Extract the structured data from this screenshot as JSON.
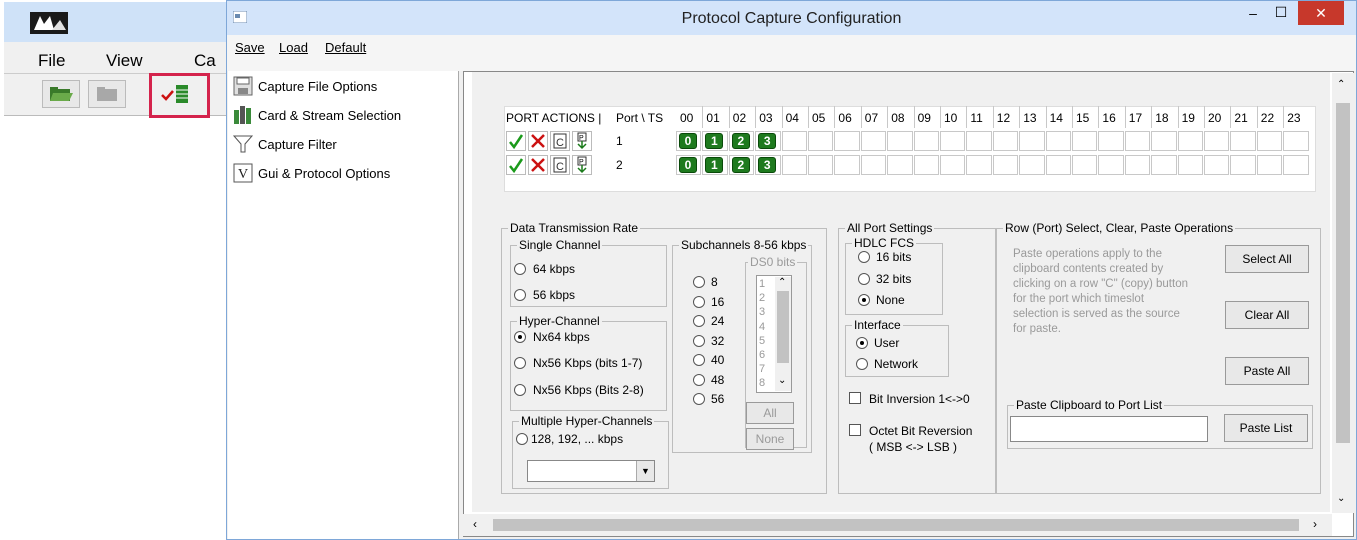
{
  "background_app": {
    "menu": [
      "File",
      "View",
      "Ca"
    ]
  },
  "window": {
    "title": "Protocol Capture Configuration",
    "controls": {
      "minimize": "–",
      "maximize": "☐",
      "close": "✕"
    }
  },
  "menu": {
    "save": "Save",
    "load": "Load",
    "default": "Default"
  },
  "nav": {
    "items": [
      {
        "label": "Capture File Options",
        "icon": "disk-icon"
      },
      {
        "label": "Card & Stream Selection",
        "icon": "card-stream-icon"
      },
      {
        "label": "Capture Filter",
        "icon": "funnel-icon"
      },
      {
        "label": "Gui & Protocol Options",
        "icon": "v-letter-icon"
      }
    ]
  },
  "grid": {
    "port_actions_header": "PORT ACTIONS  |",
    "port_ts_header": "Port \\ TS",
    "timeslots": [
      "00",
      "01",
      "02",
      "03",
      "04",
      "05",
      "06",
      "07",
      "08",
      "09",
      "10",
      "11",
      "12",
      "13",
      "14",
      "15",
      "16",
      "17",
      "18",
      "19",
      "20",
      "21",
      "22",
      "23"
    ],
    "rows": [
      {
        "port": "1",
        "selected_ts": [
          "0",
          "1",
          "2",
          "3"
        ],
        "action_icons": [
          "check-icon",
          "x-icon",
          "copy-icon",
          "paste-icon"
        ]
      },
      {
        "port": "2",
        "selected_ts": [
          "0",
          "1",
          "2",
          "3"
        ],
        "action_icons": [
          "check-icon",
          "x-icon",
          "copy-icon",
          "paste-icon"
        ]
      }
    ],
    "colors": {
      "selected_cell": "#1e7a1e",
      "check": "#1a9a1a",
      "x": "#cc1111"
    }
  },
  "data_rate": {
    "title": "Data Transmission Rate",
    "single_channel": {
      "title": "Single Channel",
      "options": [
        "64 kbps",
        "56 kbps"
      ]
    },
    "hyper_channel": {
      "title": "Hyper-Channel",
      "options": [
        "Nx64 kbps",
        "Nx56 Kbps (bits 1-7)",
        "Nx56 Kbps (Bits 2-8)"
      ],
      "selected": "Nx64 kbps"
    },
    "multiple_hyper": {
      "title": "Multiple Hyper-Channels",
      "option": "128, 192, ... kbps",
      "dropdown_value": ""
    },
    "subchannels": {
      "title": "Subchannels 8-56 kbps",
      "options": [
        "8",
        "16",
        "24",
        "32",
        "40",
        "48",
        "56"
      ],
      "ds0_title": "DS0 bits",
      "ds0_bits": [
        "1",
        "2",
        "3",
        "4",
        "5",
        "6",
        "7",
        "8"
      ],
      "all_label": "All",
      "none_label": "None"
    }
  },
  "all_port": {
    "title": "All Port Settings",
    "hdlc": {
      "title": "HDLC FCS",
      "options": [
        "16 bits",
        "32 bits",
        "None"
      ],
      "selected": "None"
    },
    "interface": {
      "title": "Interface",
      "options": [
        "User",
        "Network"
      ],
      "selected": "User"
    },
    "bit_inversion": "Bit Inversion  1<->0",
    "octet_reversal": "Octet Bit Reversion",
    "octet_reversal_sub": "( MSB <-> LSB )"
  },
  "row_ops": {
    "title": "Row (Port) Select, Clear, Paste Operations",
    "help_text": [
      "Paste operations apply to the",
      "clipboard contents created by",
      "clicking on a row \"C\" (copy) button",
      "for the port which timeslot",
      "selection is served as the source",
      "for paste."
    ],
    "select_all": "Select All",
    "clear_all": "Clear All",
    "paste_all": "Paste All",
    "paste_clipboard_title": "Paste Clipboard to Port List",
    "paste_input_value": "",
    "paste_list": "Paste List"
  }
}
